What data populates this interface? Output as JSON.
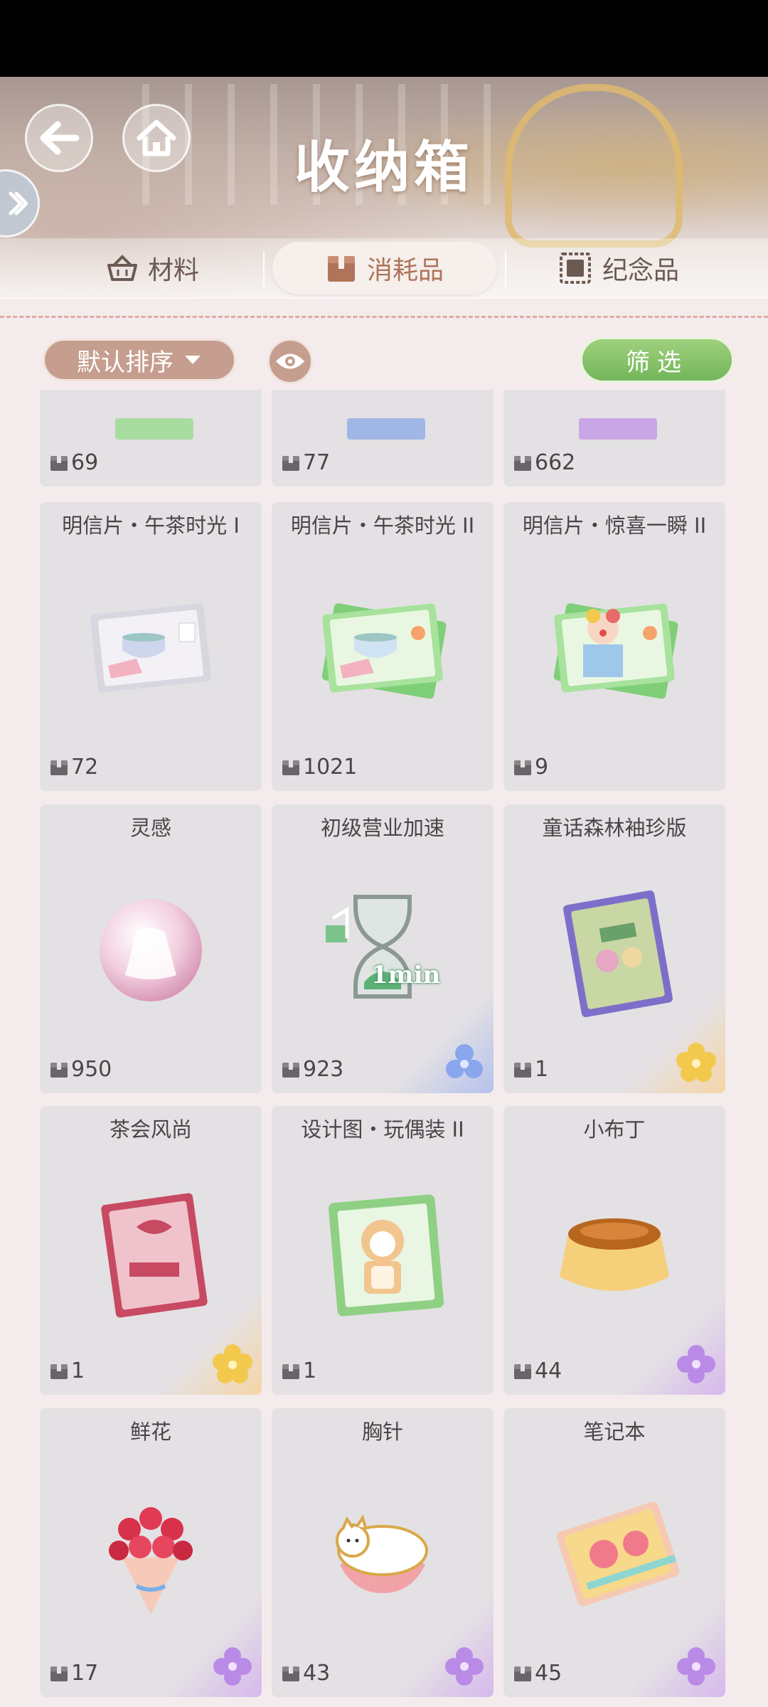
{
  "header": {
    "title": "收纳箱",
    "back_icon": "arrow-left-icon",
    "home_icon": "home-icon",
    "side_icon": "chevron-right-icon"
  },
  "tabs": [
    {
      "label": "材料",
      "icon": "basket-icon",
      "active": false
    },
    {
      "label": "消耗品",
      "icon": "box-icon",
      "active": true
    },
    {
      "label": "纪念品",
      "icon": "stamp-icon",
      "active": false
    }
  ],
  "toolbar": {
    "sort_label": "默认排序",
    "filter_label": "筛选"
  },
  "items": [
    {
      "name": "",
      "count": "69",
      "rarity": "none"
    },
    {
      "name": "",
      "count": "77",
      "rarity": "none"
    },
    {
      "name": "",
      "count": "662",
      "rarity": "none"
    },
    {
      "name": "明信片・午茶时光 I",
      "count": "72",
      "rarity": "none"
    },
    {
      "name": "明信片・午茶时光 II",
      "count": "1021",
      "rarity": "none"
    },
    {
      "name": "明信片・惊喜一瞬 II",
      "count": "9",
      "rarity": "none"
    },
    {
      "name": "灵感",
      "count": "950",
      "rarity": "none"
    },
    {
      "name": "初级营业加速",
      "count": "923",
      "rarity": "blue"
    },
    {
      "name": "童话森林袖珍版",
      "count": "1",
      "rarity": "gold"
    },
    {
      "name": "茶会风尚",
      "count": "1",
      "rarity": "gold"
    },
    {
      "name": "设计图・玩偶装 II",
      "count": "1",
      "rarity": "none"
    },
    {
      "name": "小布丁",
      "count": "44",
      "rarity": "purple"
    },
    {
      "name": "鲜花",
      "count": "17",
      "rarity": "purple"
    },
    {
      "name": "胸针",
      "count": "43",
      "rarity": "purple"
    },
    {
      "name": "笔记本",
      "count": "45",
      "rarity": "purple"
    }
  ],
  "art_labels": {
    "speedup_badge": "1min"
  },
  "colors": {
    "accent": "#c69e8f",
    "filter_green": "#7fbe63",
    "active_tab_text": "#b0745a"
  }
}
